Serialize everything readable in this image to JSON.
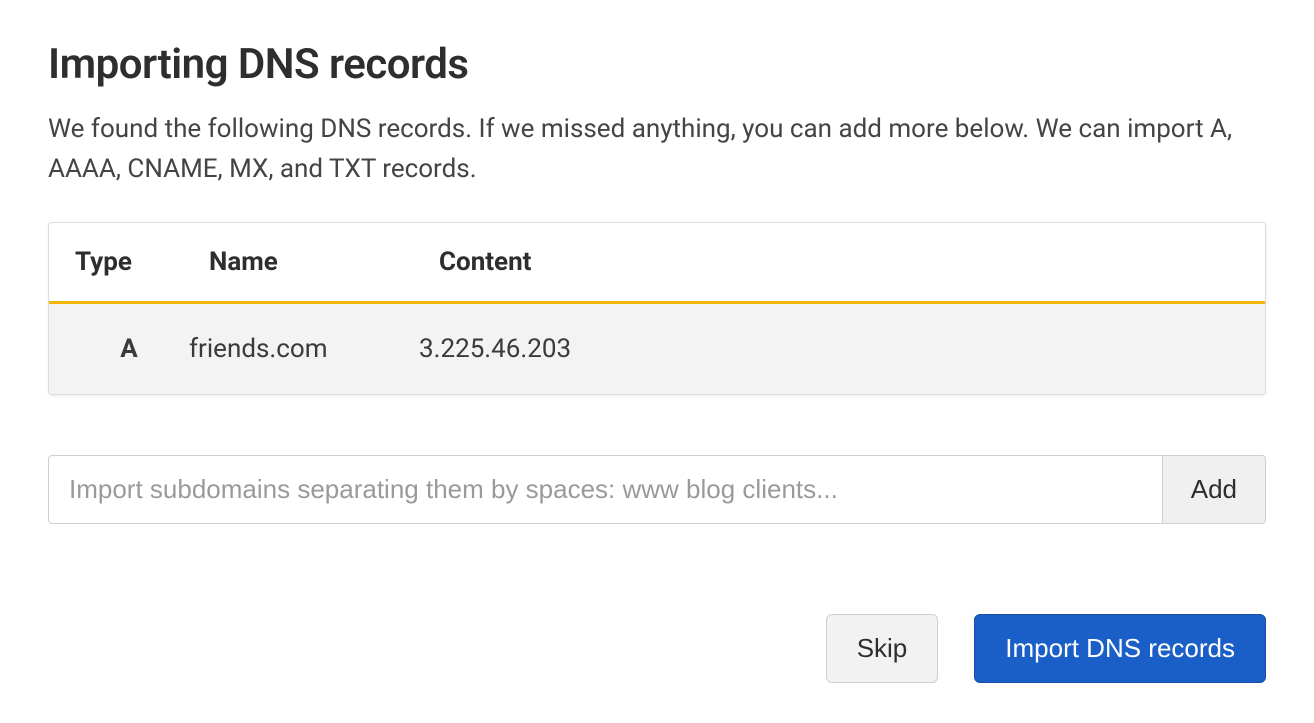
{
  "header": {
    "title": "Importing DNS records",
    "description": "We found the following DNS records. If we missed anything, you can add more below. We can import A, AAAA, CNAME, MX, and TXT records."
  },
  "table": {
    "columns": {
      "type": "Type",
      "name": "Name",
      "content": "Content"
    },
    "rows": [
      {
        "type": "A",
        "name": "friends.com",
        "content": "3.225.46.203"
      }
    ]
  },
  "subdomain": {
    "placeholder": "Import subdomains separating them by spaces: www blog clients...",
    "add_label": "Add"
  },
  "actions": {
    "skip_label": "Skip",
    "import_label": "Import DNS records"
  }
}
